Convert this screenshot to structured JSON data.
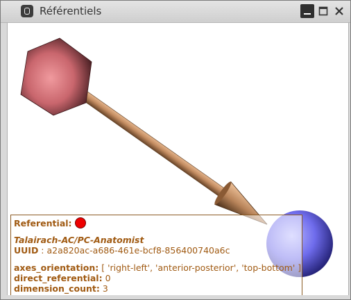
{
  "window": {
    "title": "Référentiels"
  },
  "colors": {
    "hexagon": "#d4777c",
    "arrow": "#c8946a",
    "sphere": "#7a78ee",
    "info_text": "#a05a12",
    "referential_dot": "#ee0000"
  },
  "icons": {
    "app": "app-icon",
    "minimize": "minimize-icon",
    "maximize": "maximize-icon",
    "close": "close-icon"
  },
  "info": {
    "referential_label": "Referential:",
    "name": "Talairach-AC/PC-Anatomist",
    "uuid_label": "UUID",
    "uuid_value": " : a2a820ac-a686-461e-bcf8-856400740a6c",
    "axes_label": "axes_orientation:",
    "axes_value": " [ 'right-left', 'anterior-posterior', 'top-bottom' ]",
    "direct_label": "direct_referential:",
    "direct_value": " 0",
    "dimension_label": "dimension_count:",
    "dimension_value": " 3"
  }
}
